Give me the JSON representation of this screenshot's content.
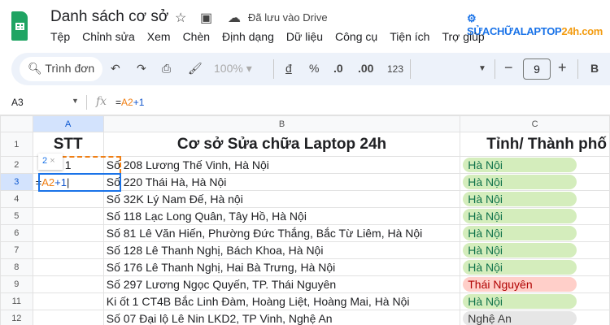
{
  "app": {
    "title": "Danh sách cơ sở",
    "saved_status": "Đã lưu vào Drive",
    "brand_a": "SỬACHỮALAPTOP",
    "brand_b": "24h.com"
  },
  "menu": [
    "Tệp",
    "Chỉnh sửa",
    "Xem",
    "Chèn",
    "Định dạng",
    "Dữ liệu",
    "Công cụ",
    "Tiện ích",
    "Trợ giúp"
  ],
  "toolbar": {
    "search": "Trình đơn",
    "zoom": "100%",
    "currency": "đ",
    "percent": "%",
    "dec_dec": ".0",
    "dec_inc": ".00",
    "format_123": "123",
    "font_size": "9",
    "bold": "B"
  },
  "formula_bar": {
    "cell_ref": "A3",
    "fx": "fx",
    "formula_eq": "=",
    "formula_ref": "A2",
    "formula_rest": "+1"
  },
  "tooltip": {
    "value": "2",
    "close": "×"
  },
  "columns": [
    "A",
    "B",
    "C"
  ],
  "header_row": {
    "stt": "STT",
    "name": "Cơ sở Sửa chữa Laptop 24h",
    "province": "Tỉnh/ Thành phố"
  },
  "rows": [
    {
      "n": "2",
      "stt": "1",
      "addr": "Số 208 Lương Thế Vinh, Hà Nội",
      "prov": "Hà Nội",
      "c": "g"
    },
    {
      "n": "3",
      "stt": "=A2+1",
      "addr": "Số 220 Thái Hà, Hà Nội",
      "prov": "Hà Nội",
      "c": "g"
    },
    {
      "n": "4",
      "stt": "",
      "addr": "Số 32K Lý Nam Đế, Hà nội",
      "prov": "Hà Nội",
      "c": "g"
    },
    {
      "n": "5",
      "stt": "",
      "addr": "Số 118 Lạc Long Quân, Tây Hồ, Hà Nội",
      "prov": "Hà Nội",
      "c": "g"
    },
    {
      "n": "6",
      "stt": "",
      "addr": "Số 81 Lê Văn Hiến, Phường Đức Thắng, Bắc Từ Liêm, Hà Nội",
      "prov": "Hà Nội",
      "c": "g"
    },
    {
      "n": "7",
      "stt": "",
      "addr": "Số 128 Lê Thanh Nghị, Bách Khoa, Hà Nội",
      "prov": "Hà Nội",
      "c": "g"
    },
    {
      "n": "8",
      "stt": "",
      "addr": "Số 176 Lê Thanh Nghị, Hai Bà Trưng, Hà Nội",
      "prov": "Hà Nội",
      "c": "g"
    },
    {
      "n": "9",
      "stt": "",
      "addr": "Số 297 Lương Ngọc Quyến, TP. Thái Nguyên",
      "prov": "Thái Nguyên",
      "c": "r"
    },
    {
      "n": "11",
      "stt": "",
      "addr": "Ki ốt 1 CT4B Bắc Linh Đàm, Hoàng Liệt, Hoàng Mai, Hà Nội",
      "prov": "Hà Nội",
      "c": "g"
    },
    {
      "n": "12",
      "stt": "",
      "addr": "Số 07 Đại lộ Lê Nin LKD2, TP Vinh, Nghệ An",
      "prov": "Nghệ An",
      "c": "n"
    }
  ]
}
